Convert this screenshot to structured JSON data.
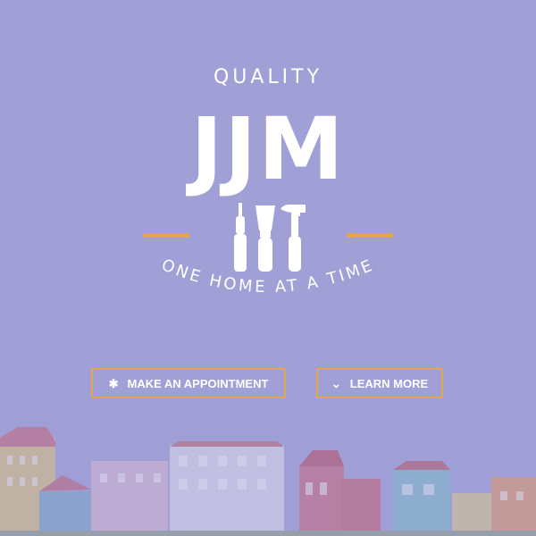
{
  "hero": {
    "eyebrow": "QUALITY",
    "brand": "JJM",
    "tagline": "ONE HOME AT A TIME"
  },
  "buttons": {
    "appointment": {
      "label": "MAKE AN APPOINTMENT",
      "icon": "asterisk-icon",
      "glyph": "✱"
    },
    "learn_more": {
      "label": "LEARN MORE",
      "icon": "chevron-down-icon",
      "glyph": "⌄"
    }
  },
  "colors": {
    "background": "#a09fd6",
    "accent": "#e3a64a",
    "text": "#ffffff"
  }
}
